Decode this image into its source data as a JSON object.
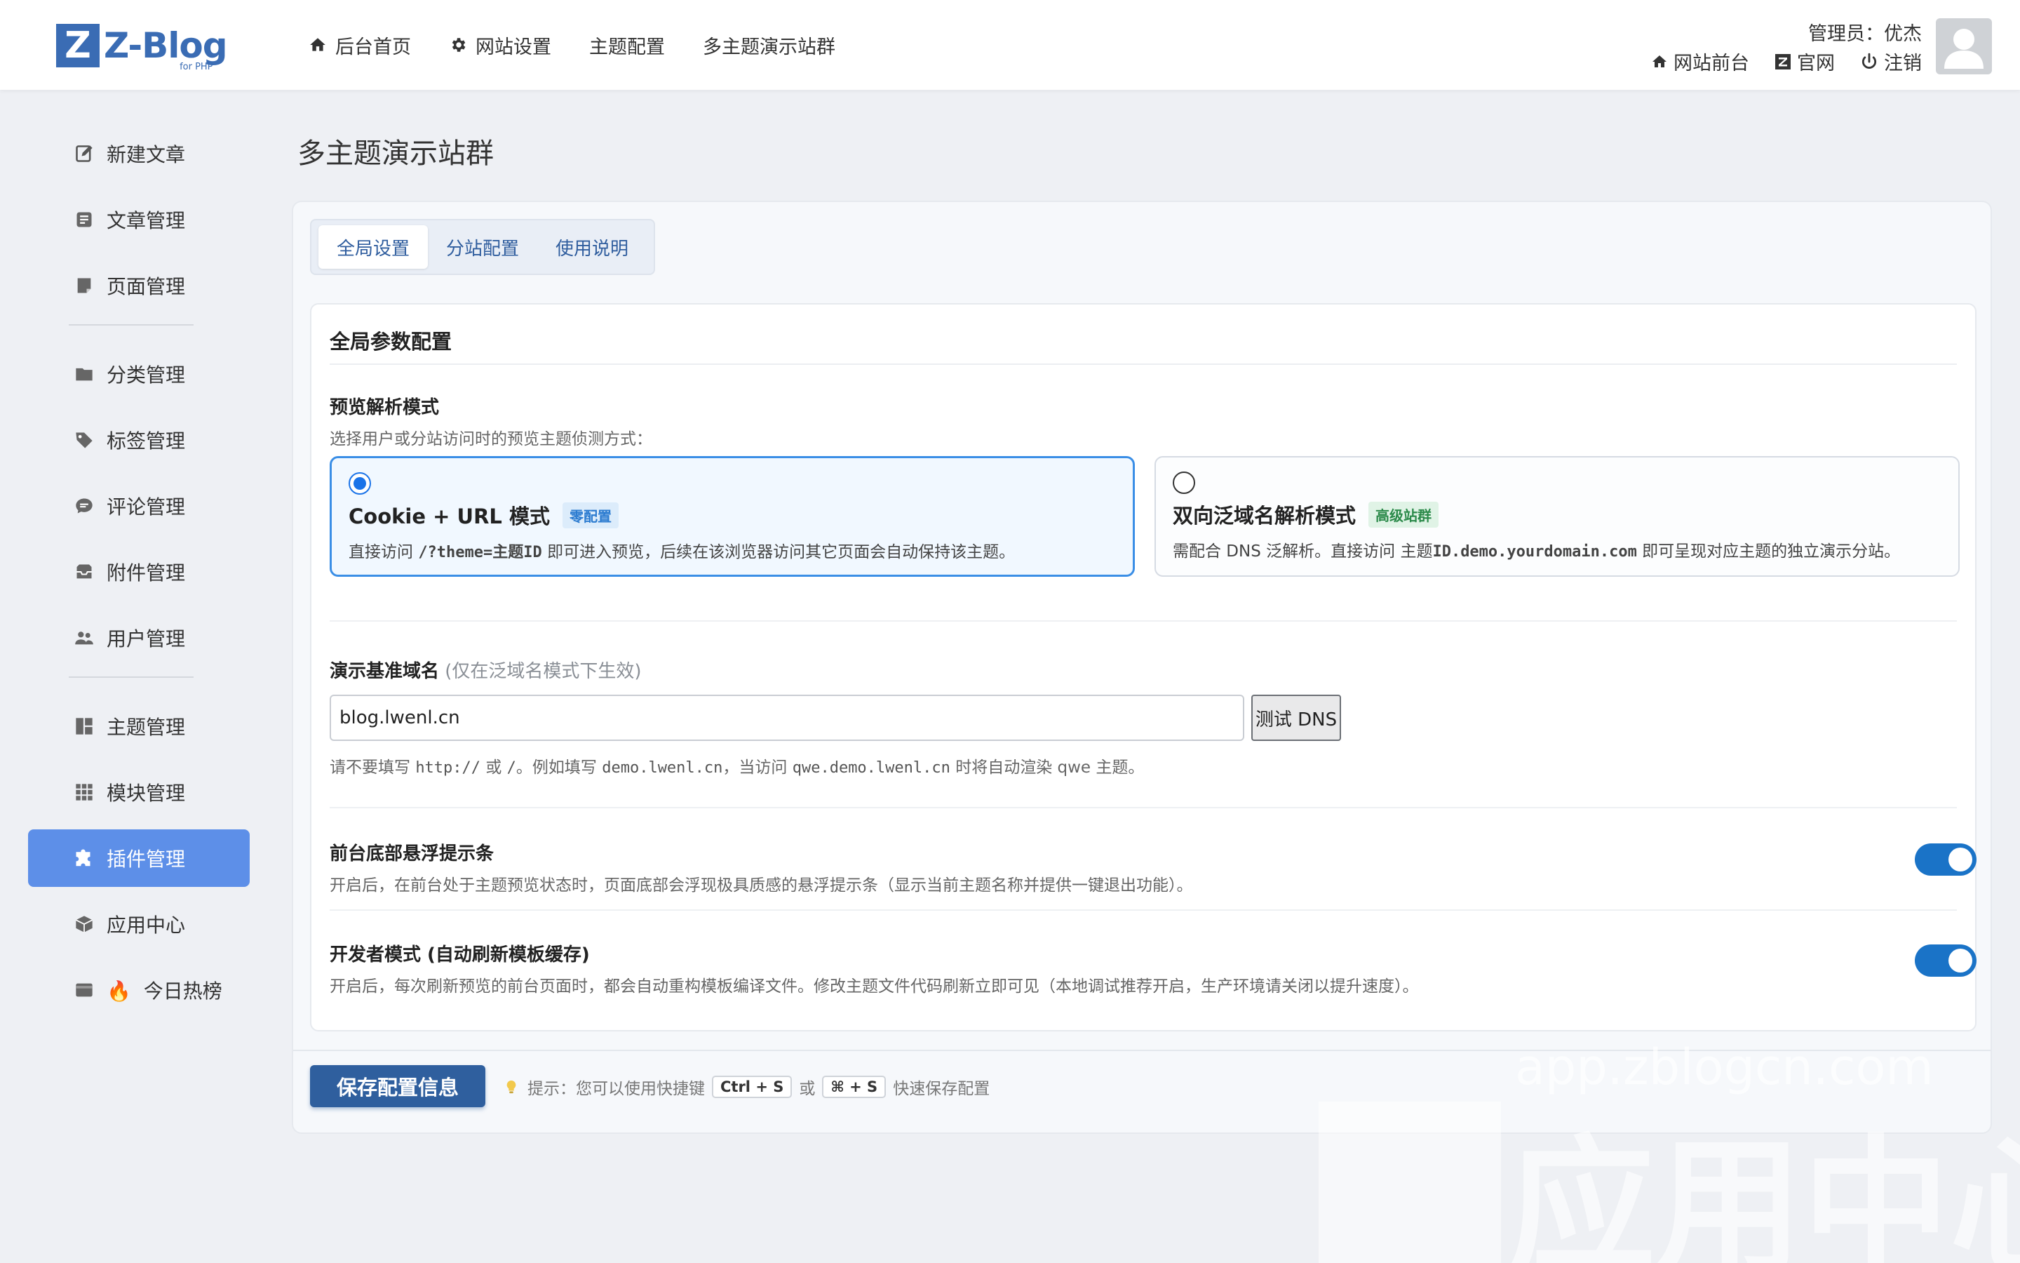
{
  "header": {
    "logo_letter": "Z",
    "logo_text": "Z-Blog",
    "logo_sub": "for PHP",
    "nav": [
      {
        "label": "后台首页",
        "icon": "home-icon"
      },
      {
        "label": "网站设置",
        "icon": "gear-icon"
      },
      {
        "label": "主题配置",
        "icon": ""
      },
      {
        "label": "多主题演示站群",
        "icon": ""
      }
    ],
    "admin_line": "管理员：优杰",
    "links": [
      {
        "label": "网站前台",
        "icon": "home-icon"
      },
      {
        "label": "官网",
        "icon": "zblog-icon"
      },
      {
        "label": "注销",
        "icon": "power-icon"
      }
    ]
  },
  "sidebar": {
    "items": [
      {
        "label": "新建文章",
        "icon": "edit-icon"
      },
      {
        "label": "文章管理",
        "icon": "article-icon"
      },
      {
        "label": "页面管理",
        "icon": "page-icon"
      },
      {
        "label": "分类管理",
        "icon": "folder-icon"
      },
      {
        "label": "标签管理",
        "icon": "tag-icon"
      },
      {
        "label": "评论管理",
        "icon": "comment-icon"
      },
      {
        "label": "附件管理",
        "icon": "inbox-icon"
      },
      {
        "label": "用户管理",
        "icon": "users-icon"
      },
      {
        "label": "主题管理",
        "icon": "layout-icon"
      },
      {
        "label": "模块管理",
        "icon": "grid-icon"
      },
      {
        "label": "插件管理",
        "icon": "puzzle-icon"
      },
      {
        "label": "应用中心",
        "icon": "box-icon"
      },
      {
        "label": "今日热榜",
        "icon": "card-icon",
        "emoji": "🔥"
      }
    ],
    "active_index": 10
  },
  "page": {
    "title": "多主题演示站群",
    "tabs": [
      "全局设置",
      "分站配置",
      "使用说明"
    ],
    "active_tab": 0
  },
  "config": {
    "section_title": "全局参数配置",
    "preview_mode": {
      "label": "预览解析模式",
      "desc": "选择用户或分站访问时的预览主题侦测方式：",
      "options": [
        {
          "name": "Cookie + URL 模式",
          "badge": "零配置",
          "desc_a": "直接访问 ",
          "code_a": "/?theme=主题ID",
          "desc_b": " 即可进入预览，后续在该浏览器访问其它页面会自动保持该主题。",
          "selected": true
        },
        {
          "name": "双向泛域名解析模式",
          "badge": "高级站群",
          "desc_a": "需配合 DNS 泛解析。直接访问 主题",
          "code_a": "ID.demo.yourdomain.com",
          "desc_b": " 即可呈现对应主题的独立演示分站。",
          "selected": false
        }
      ]
    },
    "domain": {
      "label": "演示基准域名",
      "label_note": "(仅在泛域名模式下生效)",
      "value": "blog.lwenl.cn",
      "test_button": "测试 DNS",
      "hint_1": "请不要填写 ",
      "hint_code_1": "http://",
      "hint_2": " 或 ",
      "hint_code_2": "/",
      "hint_3": "。例如填写 ",
      "hint_code_3": "demo.lwenl.cn",
      "hint_4": "，当访问 ",
      "hint_code_4": "qwe.demo.lwenl.cn",
      "hint_5": " 时将自动渲染 qwe 主题。"
    },
    "floating_bar": {
      "label": "前台底部悬浮提示条",
      "desc": "开启后，在前台处于主题预览状态时，页面底部会浮现极具质感的悬浮提示条（显示当前主题名称并提供一键退出功能）。",
      "enabled": true
    },
    "dev_mode": {
      "label": "开发者模式 (自动刷新模板缓存)",
      "desc": "开启后，每次刷新预览的前台页面时，都会自动重构模板编译文件。修改主题文件代码刷新立即可见（本地调试推荐开启，生产环境请关闭以提升速度）。",
      "enabled": true
    }
  },
  "footer": {
    "save_label": "保存配置信息",
    "tip_prefix": "提示：您可以使用快捷键",
    "key_1": "Ctrl + S",
    "tip_or": "或",
    "key_2": "⌘ + S",
    "tip_suffix": "快速保存配置"
  },
  "watermark": {
    "url": "app.zblogcn.com",
    "text": "应用中心"
  },
  "colors": {
    "brand": "#3a6cb4",
    "active_sidebar": "#5d8fe8",
    "toggle_on": "#1a73c7",
    "save_button": "#2f5f9e"
  }
}
